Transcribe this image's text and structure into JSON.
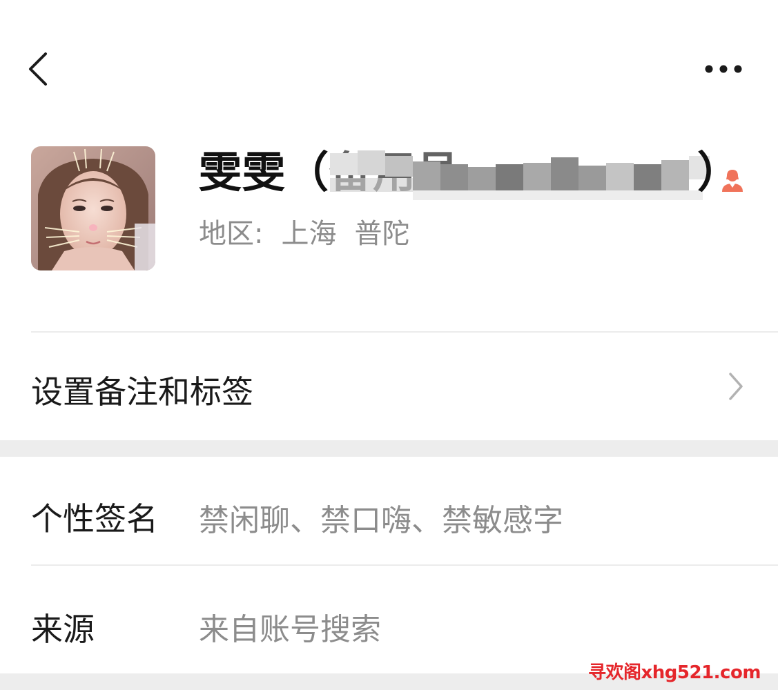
{
  "header": {
    "back_icon": "chevron-left-icon",
    "more_icon": "more-horizontal-icon"
  },
  "profile": {
    "name": "雯雯（备用号",
    "name_suffix": "）",
    "gender_icon": "female-user-icon",
    "gender_color": "#f0735a",
    "region_label": "地区:",
    "region_city": "上海",
    "region_district": "普陀"
  },
  "menu": {
    "remark_tags_label": "设置备注和标签",
    "signature_label": "个性签名",
    "signature_value": "禁闲聊、禁口嗨、禁敏感字",
    "source_label": "来源",
    "source_value": "来自账号搜索"
  },
  "watermark": {
    "text": "寻欢阁xhg521.com",
    "color": "#e5262b"
  },
  "colors": {
    "background": "#ffffff",
    "section_gap": "#ededed",
    "secondary_text": "#8c8c8c"
  }
}
